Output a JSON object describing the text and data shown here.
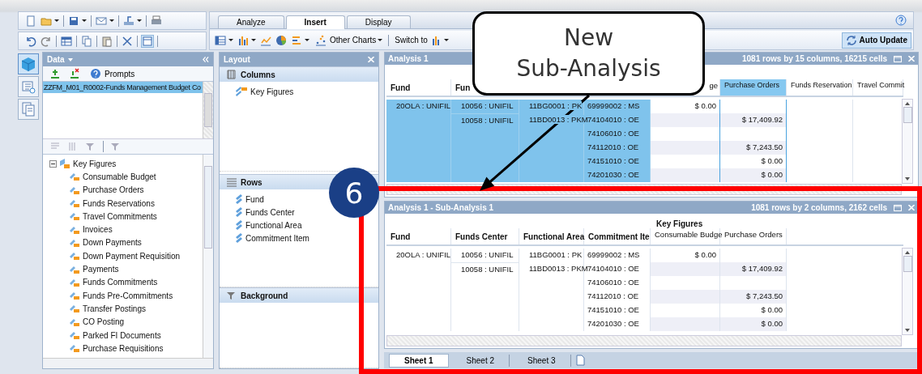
{
  "ribbon_tabs": [
    {
      "label": "Analyze",
      "selected": false
    },
    {
      "label": "Insert",
      "selected": true
    },
    {
      "label": "Display",
      "selected": false
    }
  ],
  "ribbon": {
    "other_charts": "Other Charts",
    "switch_to": "Switch to",
    "auto_update": "Auto Update"
  },
  "side_icons": [
    {
      "selected": true
    },
    {
      "selected": false
    },
    {
      "selected": false
    }
  ],
  "data_panel": {
    "title": "Data",
    "prompts": "Prompts",
    "sources": [
      {
        "label": "ZZFM_M01_R0002-Funds Management Budget Co",
        "selected": true
      }
    ],
    "tree": {
      "label": "Key Figures",
      "expanded": true,
      "children": [
        {
          "label": "Consumable Budget"
        },
        {
          "label": "Purchase Orders"
        },
        {
          "label": "Funds Reservations"
        },
        {
          "label": "Travel Commitments"
        },
        {
          "label": "Invoices"
        },
        {
          "label": "Down Payments"
        },
        {
          "label": "Down Payment Requisition"
        },
        {
          "label": "Payments"
        },
        {
          "label": "Funds Commitments"
        },
        {
          "label": "Funds Pre-Commitments"
        },
        {
          "label": "Transfer Postings"
        },
        {
          "label": "CO Posting"
        },
        {
          "label": "Parked FI Documents"
        },
        {
          "label": "Purchase Requisitions"
        }
      ]
    }
  },
  "layout_panel": {
    "title": "Layout",
    "sections": [
      {
        "title": "Columns",
        "kind": "columns",
        "items": [
          "Key Figures"
        ]
      },
      {
        "title": "Rows",
        "kind": "rows",
        "items": [
          "Fund",
          "Funds Center",
          "Functional Area",
          "Commitment Item"
        ]
      },
      {
        "title": "Background",
        "kind": "background"
      }
    ]
  },
  "analyses": [
    {
      "title": "Analysis 1",
      "info": "1081 rows by 15 columns, 16215 cells",
      "rows_selected": true,
      "columns": [
        {
          "label": "Fund",
          "selected": false
        },
        {
          "label": "Fun",
          "selected": false
        },
        {},
        {},
        {
          "label": "ge",
          "selected": false
        },
        {
          "label": "Purchase Orders",
          "selected": true
        },
        {
          "label": "Funds Reservation",
          "selected": false
        },
        {
          "label": "Travel Commit",
          "selected": false
        }
      ],
      "rows": [
        {
          "fund": "20OLA : UNIFIL",
          "funds_center": "10056 : UNIFIL",
          "functional_area": "11BG0001 : PK",
          "commitment_item": "69999002 : MS",
          "consumable_budget": "$ 0.00"
        },
        {
          "funds_center": "10058 : UNIFIL",
          "functional_area": "11BD0013 : PKM",
          "commitment_item": "74104010 : OE",
          "purchase_orders": "$ 17,409.92"
        },
        {
          "commitment_item": "74106010 : OE"
        },
        {
          "commitment_item": "74112010 : OE",
          "purchase_orders": "$ 7,243.50"
        },
        {
          "commitment_item": "74151010 : OE",
          "purchase_orders": "$ 0.00"
        },
        {
          "commitment_item": "74201030 : OE",
          "purchase_orders": "$ 0.00"
        }
      ]
    },
    {
      "title": "Analysis 1 - Sub-Analysis 1",
      "info": "1081 rows by 2 columns, 2162 cells",
      "rows_selected": false,
      "column_group": "Key Figures",
      "columns": [
        {
          "label": "Fund",
          "selected": false
        },
        {
          "label": "Funds Center",
          "selected": false
        },
        {
          "label": "Functional Area",
          "selected": false
        },
        {
          "label": "Commitment Ite",
          "selected": false
        },
        {
          "label": "Consumable Budge",
          "selected": false
        },
        {
          "label": "Purchase Orders",
          "selected": false
        }
      ],
      "rows": [
        {
          "fund": "20OLA : UNIFIL",
          "funds_center": "10056 : UNIFIL",
          "functional_area": "11BG0001 : PK",
          "commitment_item": "69999002 : MS",
          "consumable_budget": "$ 0.00"
        },
        {
          "funds_center": "10058 : UNIFIL",
          "functional_area": "11BD0013 : PKM",
          "commitment_item": "74104010 : OE",
          "purchase_orders": "$ 17,409.92"
        },
        {
          "commitment_item": "74106010 : OE"
        },
        {
          "commitment_item": "74112010 : OE",
          "purchase_orders": "$ 7,243.50"
        },
        {
          "commitment_item": "74151010 : OE",
          "purchase_orders": "$ 0.00"
        },
        {
          "commitment_item": "74201030 : OE",
          "purchase_orders": "$ 0.00"
        }
      ]
    }
  ],
  "sheets": [
    {
      "label": "Sheet 1",
      "selected": true
    },
    {
      "label": "Sheet 2",
      "selected": false
    },
    {
      "label": "Sheet 3",
      "selected": false
    }
  ],
  "callout": {
    "lines": [
      "New",
      "Sub-Analysis"
    ]
  },
  "step_badge": "6"
}
